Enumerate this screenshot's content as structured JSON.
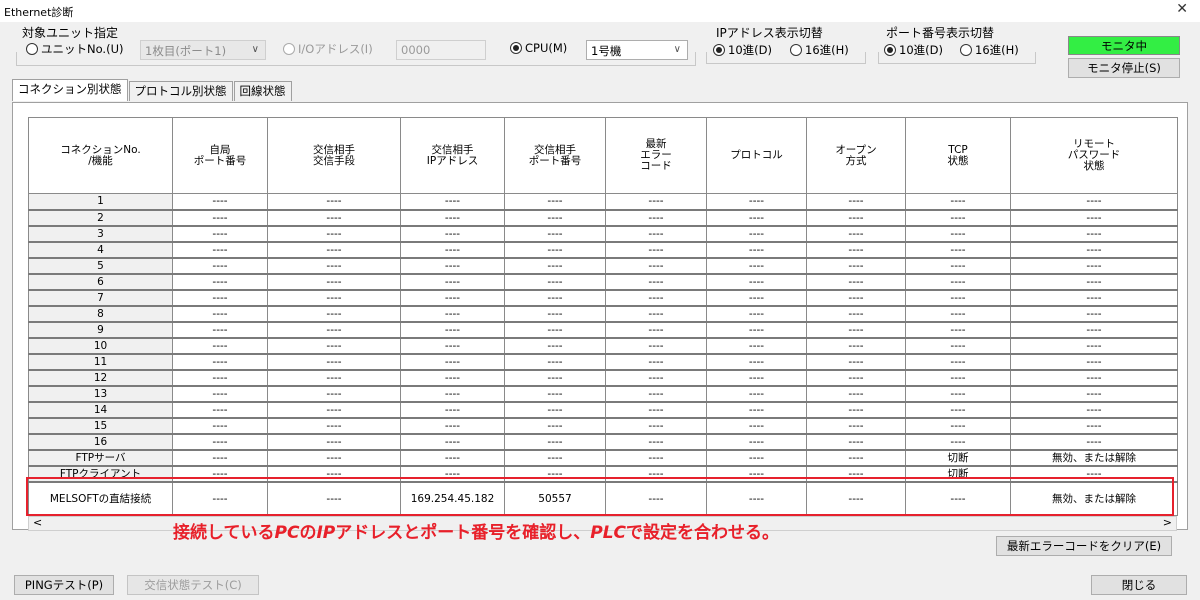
{
  "window": {
    "title": "Ethernet診断"
  },
  "target_unit": {
    "group_label": "対象ユニット指定",
    "unit_no_label": "ユニットNo.(U)",
    "unit_select_value": "1枚目(ポート1)",
    "io_address_label": "I/Oアドレス(I)",
    "io_address_value": "0000",
    "cpu_label": "CPU(M)",
    "cpu_select_value": "1号機"
  },
  "ip_display": {
    "group_label": "IPアドレス表示切替",
    "decimal_label": "10進(D)",
    "hex_label": "16進(H)"
  },
  "port_display": {
    "group_label": "ポート番号表示切替",
    "decimal_label": "10進(D)",
    "hex_label": "16進(H)"
  },
  "monitor": {
    "status_label": "モニタ中",
    "stop_label": "モニタ停止(S)",
    "status_color": "#33ee44"
  },
  "tabs": [
    {
      "label": "コネクション別状態"
    },
    {
      "label": "プロトコル別状態"
    },
    {
      "label": "回線状態"
    }
  ],
  "table": {
    "headers": [
      "コネクションNo.\n/機能",
      "自局\nポート番号",
      "交信相手\n交信手段",
      "交信相手\nIPアドレス",
      "交信相手\nポート番号",
      "最新\nエラー\nコード",
      "プロトコル",
      "オープン\n方式",
      "TCP\n状態",
      "リモート\nパスワード\n状態"
    ],
    "rows": [
      [
        "1",
        "----",
        "----",
        "----",
        "----",
        "----",
        "----",
        "----",
        "----",
        "----"
      ],
      [
        "2",
        "----",
        "----",
        "----",
        "----",
        "----",
        "----",
        "----",
        "----",
        "----"
      ],
      [
        "3",
        "----",
        "----",
        "----",
        "----",
        "----",
        "----",
        "----",
        "----",
        "----"
      ],
      [
        "4",
        "----",
        "----",
        "----",
        "----",
        "----",
        "----",
        "----",
        "----",
        "----"
      ],
      [
        "5",
        "----",
        "----",
        "----",
        "----",
        "----",
        "----",
        "----",
        "----",
        "----"
      ],
      [
        "6",
        "----",
        "----",
        "----",
        "----",
        "----",
        "----",
        "----",
        "----",
        "----"
      ],
      [
        "7",
        "----",
        "----",
        "----",
        "----",
        "----",
        "----",
        "----",
        "----",
        "----"
      ],
      [
        "8",
        "----",
        "----",
        "----",
        "----",
        "----",
        "----",
        "----",
        "----",
        "----"
      ],
      [
        "9",
        "----",
        "----",
        "----",
        "----",
        "----",
        "----",
        "----",
        "----",
        "----"
      ],
      [
        "10",
        "----",
        "----",
        "----",
        "----",
        "----",
        "----",
        "----",
        "----",
        "----"
      ],
      [
        "11",
        "----",
        "----",
        "----",
        "----",
        "----",
        "----",
        "----",
        "----",
        "----"
      ],
      [
        "12",
        "----",
        "----",
        "----",
        "----",
        "----",
        "----",
        "----",
        "----",
        "----"
      ],
      [
        "13",
        "----",
        "----",
        "----",
        "----",
        "----",
        "----",
        "----",
        "----",
        "----"
      ],
      [
        "14",
        "----",
        "----",
        "----",
        "----",
        "----",
        "----",
        "----",
        "----",
        "----"
      ],
      [
        "15",
        "----",
        "----",
        "----",
        "----",
        "----",
        "----",
        "----",
        "----",
        "----"
      ],
      [
        "16",
        "----",
        "----",
        "----",
        "----",
        "----",
        "----",
        "----",
        "----",
        "----"
      ],
      [
        "FTPサーバ",
        "----",
        "----",
        "----",
        "----",
        "----",
        "----",
        "----",
        "切断",
        "無効、または解除"
      ],
      [
        "FTPクライアント",
        "----",
        "----",
        "----",
        "----",
        "----",
        "----",
        "----",
        "切断",
        "----"
      ]
    ],
    "melsoft_row": [
      "MELSOFTの直結接続",
      "----",
      "----",
      "169.254.45.182",
      "50557",
      "----",
      "----",
      "----",
      "----",
      "無効、または解除"
    ]
  },
  "annotation": {
    "parts": [
      "接続している",
      "PC",
      "の",
      "IP",
      "アドレスとポート番号を確認し、",
      "PLC",
      "で設定を合わせる。"
    ],
    "color": "#e8202a"
  },
  "buttons": {
    "clear_error": "最新エラーコードをクリア(E)",
    "ping": "PINGテスト(P)",
    "comm_test": "交信状態テスト(C)",
    "close": "閉じる"
  }
}
